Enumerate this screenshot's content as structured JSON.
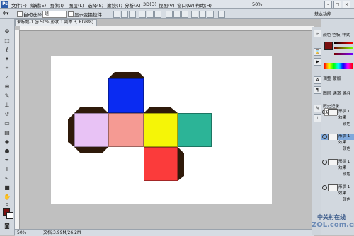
{
  "menubar": {
    "items": [
      "文件(F)",
      "编辑(E)",
      "图像(I)",
      "图层(L)",
      "选择(S)",
      "滤镜(T)",
      "分析(A)",
      "3D(D)",
      "视图(V)",
      "窗口(W)",
      "帮助(H)"
    ],
    "zoom": "50%"
  },
  "options_bar": {
    "auto_select_label": "自动选择",
    "auto_select_value": "组",
    "show_transform_label": "显示变换控件",
    "workspace": "基本功能"
  },
  "document": {
    "tab_title": "未标题-1 @ 50%(形状 1 副本 3, RGB/8)",
    "status_zoom": "50%",
    "status_doc": "文档:3.99M/26.2M"
  },
  "cube": {
    "colors": {
      "top": "#0a2bf2",
      "left": "#e8c2f5",
      "center": "#f59a93",
      "right": "#f5f507",
      "far_right": "#2cb497",
      "bottom": "#fb3b3b",
      "tab": "#2f1a0a"
    }
  },
  "panels": {
    "tabs": [
      "颜色",
      "色板",
      "样式"
    ],
    "adjust_tabs": [
      "调整",
      "蒙版"
    ],
    "layers_tabs": [
      "图层",
      "通道",
      "路径"
    ],
    "history": "历史记录",
    "blend_mode": "正常",
    "layers": [
      {
        "name": "形状 1",
        "selected": false
      },
      {
        "name": "效果",
        "selected": false
      },
      {
        "name": "颜色",
        "selected": false
      },
      {
        "name": "形状 1",
        "selected": true
      },
      {
        "name": "效果",
        "selected": false
      },
      {
        "name": "颜色",
        "selected": false
      },
      {
        "name": "形状 1",
        "selected": false
      },
      {
        "name": "效果",
        "selected": false
      },
      {
        "name": "颜色",
        "selected": false
      },
      {
        "name": "形状 1",
        "selected": false
      },
      {
        "name": "效果",
        "selected": false
      },
      {
        "name": "颜色",
        "selected": false
      }
    ]
  },
  "colors": {
    "foreground": "#7a1010",
    "background": "#ffffff"
  },
  "watermark": {
    "line1": "中关村在线",
    "line2": "ZOL.com.cn"
  }
}
